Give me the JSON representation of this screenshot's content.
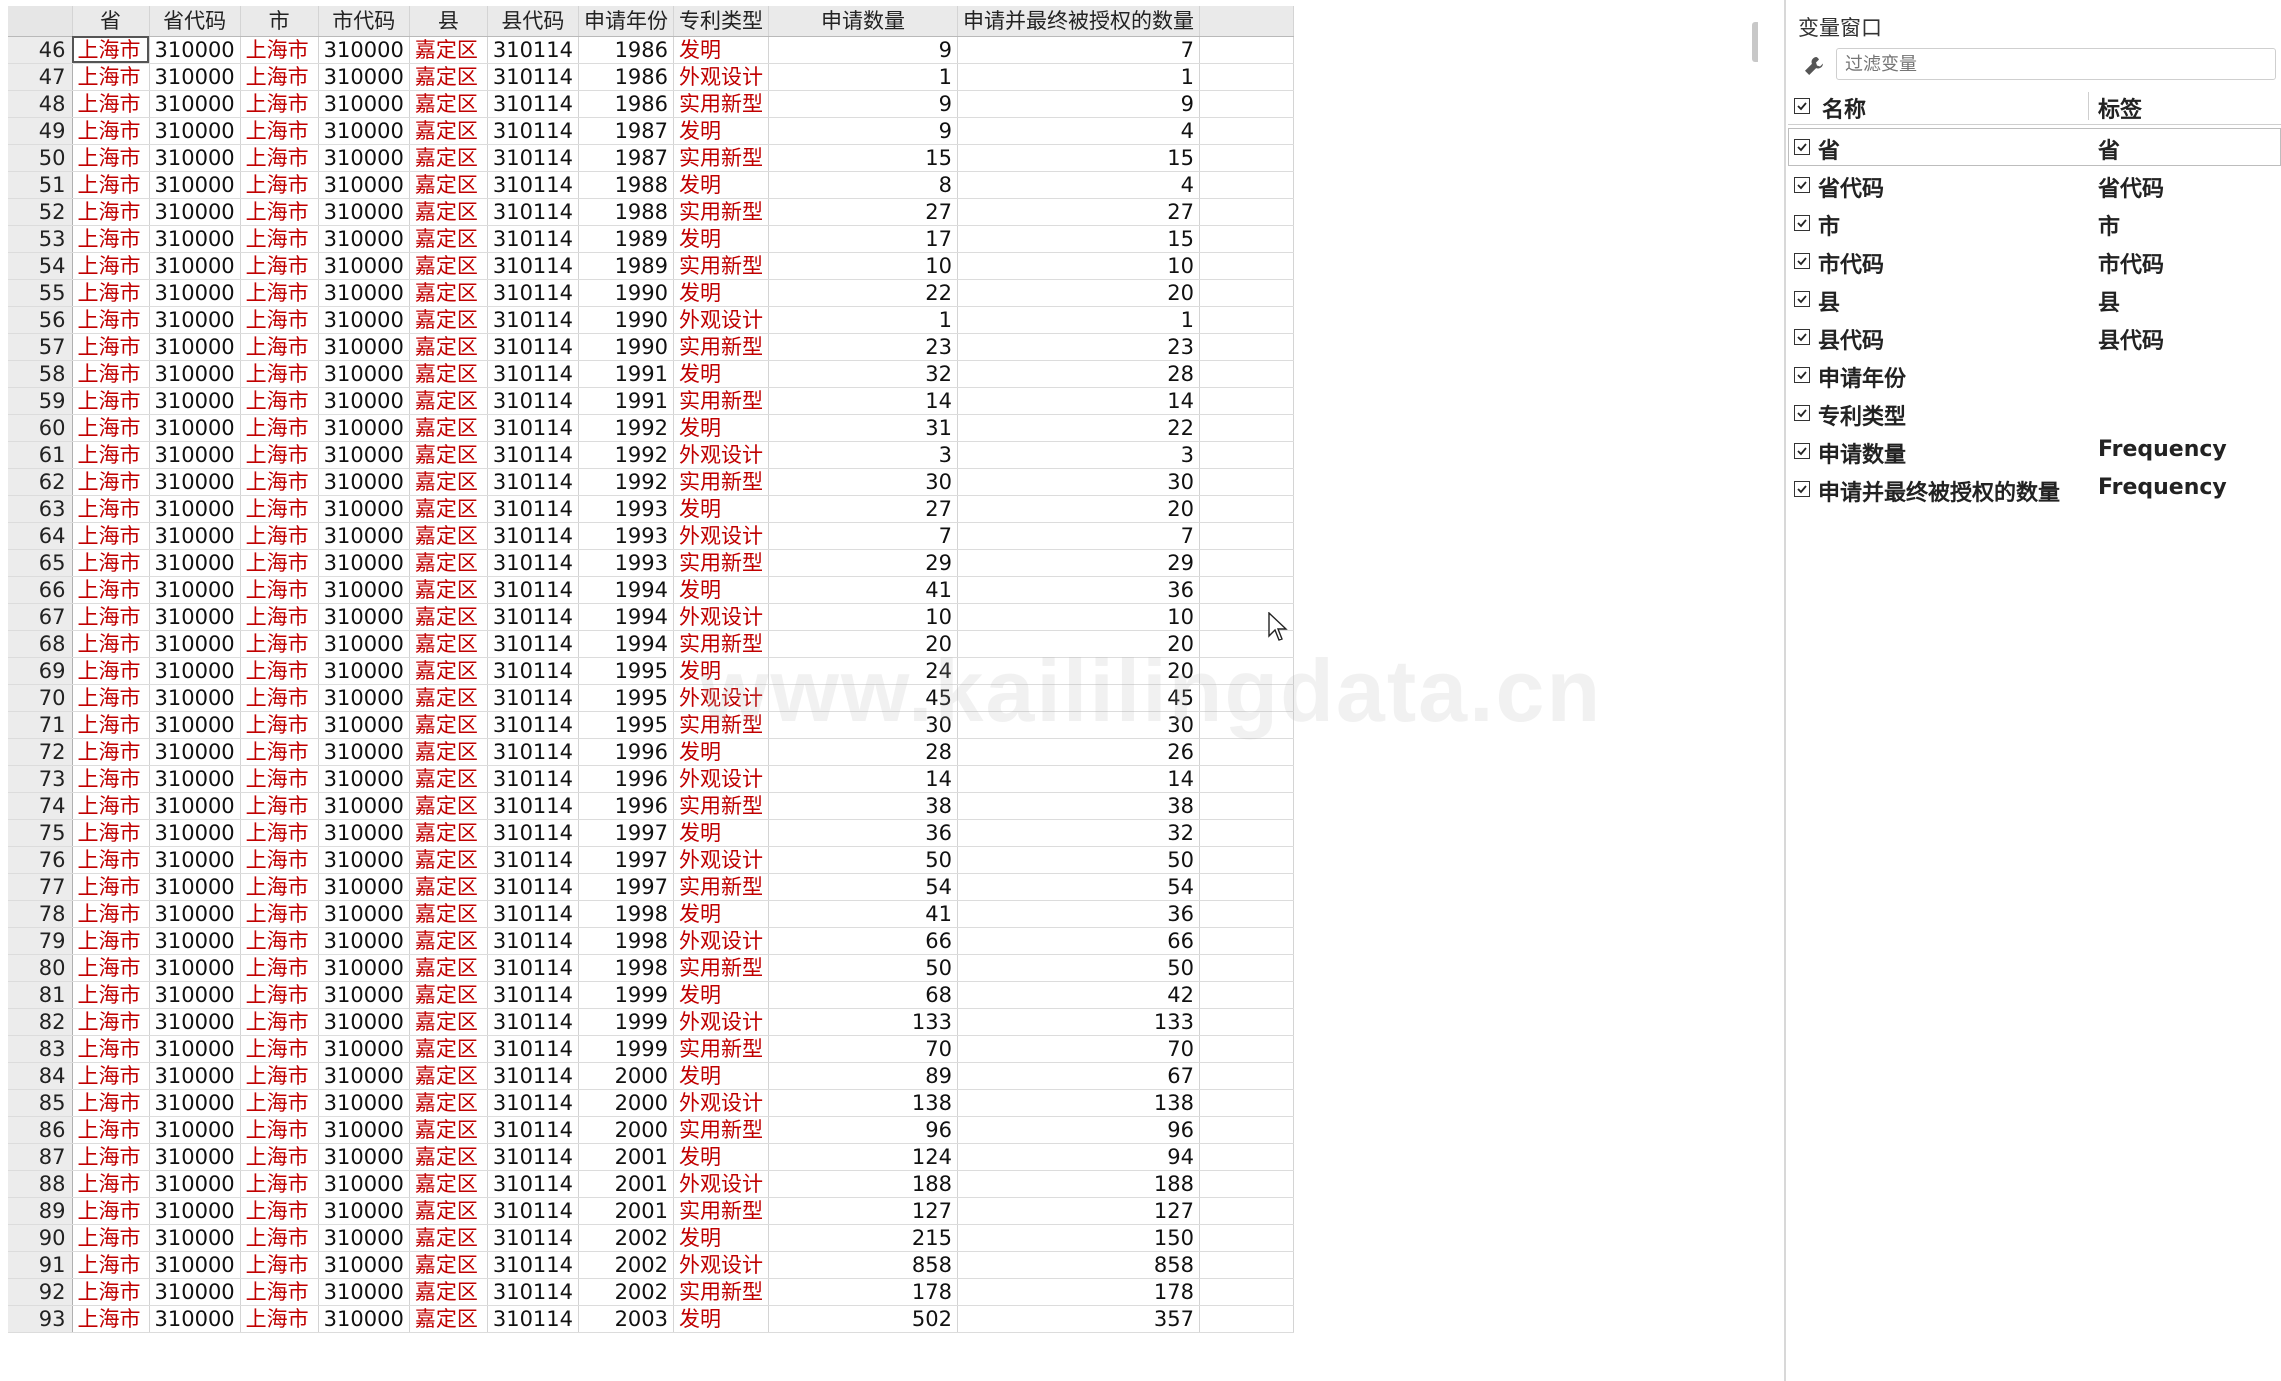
{
  "grid": {
    "columns": [
      "省",
      "省代码",
      "市",
      "市代码",
      "县",
      "县代码",
      "申请年份",
      "专利类型",
      "申请数量",
      "申请并最终被授权的数量"
    ],
    "rows": [
      [
        46,
        "上海市",
        "310000",
        "上海市",
        "310000",
        "嘉定区",
        "310114",
        "1986",
        "发明",
        "9",
        "7"
      ],
      [
        47,
        "上海市",
        "310000",
        "上海市",
        "310000",
        "嘉定区",
        "310114",
        "1986",
        "外观设计",
        "1",
        "1"
      ],
      [
        48,
        "上海市",
        "310000",
        "上海市",
        "310000",
        "嘉定区",
        "310114",
        "1986",
        "实用新型",
        "9",
        "9"
      ],
      [
        49,
        "上海市",
        "310000",
        "上海市",
        "310000",
        "嘉定区",
        "310114",
        "1987",
        "发明",
        "9",
        "4"
      ],
      [
        50,
        "上海市",
        "310000",
        "上海市",
        "310000",
        "嘉定区",
        "310114",
        "1987",
        "实用新型",
        "15",
        "15"
      ],
      [
        51,
        "上海市",
        "310000",
        "上海市",
        "310000",
        "嘉定区",
        "310114",
        "1988",
        "发明",
        "8",
        "4"
      ],
      [
        52,
        "上海市",
        "310000",
        "上海市",
        "310000",
        "嘉定区",
        "310114",
        "1988",
        "实用新型",
        "27",
        "27"
      ],
      [
        53,
        "上海市",
        "310000",
        "上海市",
        "310000",
        "嘉定区",
        "310114",
        "1989",
        "发明",
        "17",
        "15"
      ],
      [
        54,
        "上海市",
        "310000",
        "上海市",
        "310000",
        "嘉定区",
        "310114",
        "1989",
        "实用新型",
        "10",
        "10"
      ],
      [
        55,
        "上海市",
        "310000",
        "上海市",
        "310000",
        "嘉定区",
        "310114",
        "1990",
        "发明",
        "22",
        "20"
      ],
      [
        56,
        "上海市",
        "310000",
        "上海市",
        "310000",
        "嘉定区",
        "310114",
        "1990",
        "外观设计",
        "1",
        "1"
      ],
      [
        57,
        "上海市",
        "310000",
        "上海市",
        "310000",
        "嘉定区",
        "310114",
        "1990",
        "实用新型",
        "23",
        "23"
      ],
      [
        58,
        "上海市",
        "310000",
        "上海市",
        "310000",
        "嘉定区",
        "310114",
        "1991",
        "发明",
        "32",
        "28"
      ],
      [
        59,
        "上海市",
        "310000",
        "上海市",
        "310000",
        "嘉定区",
        "310114",
        "1991",
        "实用新型",
        "14",
        "14"
      ],
      [
        60,
        "上海市",
        "310000",
        "上海市",
        "310000",
        "嘉定区",
        "310114",
        "1992",
        "发明",
        "31",
        "22"
      ],
      [
        61,
        "上海市",
        "310000",
        "上海市",
        "310000",
        "嘉定区",
        "310114",
        "1992",
        "外观设计",
        "3",
        "3"
      ],
      [
        62,
        "上海市",
        "310000",
        "上海市",
        "310000",
        "嘉定区",
        "310114",
        "1992",
        "实用新型",
        "30",
        "30"
      ],
      [
        63,
        "上海市",
        "310000",
        "上海市",
        "310000",
        "嘉定区",
        "310114",
        "1993",
        "发明",
        "27",
        "20"
      ],
      [
        64,
        "上海市",
        "310000",
        "上海市",
        "310000",
        "嘉定区",
        "310114",
        "1993",
        "外观设计",
        "7",
        "7"
      ],
      [
        65,
        "上海市",
        "310000",
        "上海市",
        "310000",
        "嘉定区",
        "310114",
        "1993",
        "实用新型",
        "29",
        "29"
      ],
      [
        66,
        "上海市",
        "310000",
        "上海市",
        "310000",
        "嘉定区",
        "310114",
        "1994",
        "发明",
        "41",
        "36"
      ],
      [
        67,
        "上海市",
        "310000",
        "上海市",
        "310000",
        "嘉定区",
        "310114",
        "1994",
        "外观设计",
        "10",
        "10"
      ],
      [
        68,
        "上海市",
        "310000",
        "上海市",
        "310000",
        "嘉定区",
        "310114",
        "1994",
        "实用新型",
        "20",
        "20"
      ],
      [
        69,
        "上海市",
        "310000",
        "上海市",
        "310000",
        "嘉定区",
        "310114",
        "1995",
        "发明",
        "24",
        "20"
      ],
      [
        70,
        "上海市",
        "310000",
        "上海市",
        "310000",
        "嘉定区",
        "310114",
        "1995",
        "外观设计",
        "45",
        "45"
      ],
      [
        71,
        "上海市",
        "310000",
        "上海市",
        "310000",
        "嘉定区",
        "310114",
        "1995",
        "实用新型",
        "30",
        "30"
      ],
      [
        72,
        "上海市",
        "310000",
        "上海市",
        "310000",
        "嘉定区",
        "310114",
        "1996",
        "发明",
        "28",
        "26"
      ],
      [
        73,
        "上海市",
        "310000",
        "上海市",
        "310000",
        "嘉定区",
        "310114",
        "1996",
        "外观设计",
        "14",
        "14"
      ],
      [
        74,
        "上海市",
        "310000",
        "上海市",
        "310000",
        "嘉定区",
        "310114",
        "1996",
        "实用新型",
        "38",
        "38"
      ],
      [
        75,
        "上海市",
        "310000",
        "上海市",
        "310000",
        "嘉定区",
        "310114",
        "1997",
        "发明",
        "36",
        "32"
      ],
      [
        76,
        "上海市",
        "310000",
        "上海市",
        "310000",
        "嘉定区",
        "310114",
        "1997",
        "外观设计",
        "50",
        "50"
      ],
      [
        77,
        "上海市",
        "310000",
        "上海市",
        "310000",
        "嘉定区",
        "310114",
        "1997",
        "实用新型",
        "54",
        "54"
      ],
      [
        78,
        "上海市",
        "310000",
        "上海市",
        "310000",
        "嘉定区",
        "310114",
        "1998",
        "发明",
        "41",
        "36"
      ],
      [
        79,
        "上海市",
        "310000",
        "上海市",
        "310000",
        "嘉定区",
        "310114",
        "1998",
        "外观设计",
        "66",
        "66"
      ],
      [
        80,
        "上海市",
        "310000",
        "上海市",
        "310000",
        "嘉定区",
        "310114",
        "1998",
        "实用新型",
        "50",
        "50"
      ],
      [
        81,
        "上海市",
        "310000",
        "上海市",
        "310000",
        "嘉定区",
        "310114",
        "1999",
        "发明",
        "68",
        "42"
      ],
      [
        82,
        "上海市",
        "310000",
        "上海市",
        "310000",
        "嘉定区",
        "310114",
        "1999",
        "外观设计",
        "133",
        "133"
      ],
      [
        83,
        "上海市",
        "310000",
        "上海市",
        "310000",
        "嘉定区",
        "310114",
        "1999",
        "实用新型",
        "70",
        "70"
      ],
      [
        84,
        "上海市",
        "310000",
        "上海市",
        "310000",
        "嘉定区",
        "310114",
        "2000",
        "发明",
        "89",
        "67"
      ],
      [
        85,
        "上海市",
        "310000",
        "上海市",
        "310000",
        "嘉定区",
        "310114",
        "2000",
        "外观设计",
        "138",
        "138"
      ],
      [
        86,
        "上海市",
        "310000",
        "上海市",
        "310000",
        "嘉定区",
        "310114",
        "2000",
        "实用新型",
        "96",
        "96"
      ],
      [
        87,
        "上海市",
        "310000",
        "上海市",
        "310000",
        "嘉定区",
        "310114",
        "2001",
        "发明",
        "124",
        "94"
      ],
      [
        88,
        "上海市",
        "310000",
        "上海市",
        "310000",
        "嘉定区",
        "310114",
        "2001",
        "外观设计",
        "188",
        "188"
      ],
      [
        89,
        "上海市",
        "310000",
        "上海市",
        "310000",
        "嘉定区",
        "310114",
        "2001",
        "实用新型",
        "127",
        "127"
      ],
      [
        90,
        "上海市",
        "310000",
        "上海市",
        "310000",
        "嘉定区",
        "310114",
        "2002",
        "发明",
        "215",
        "150"
      ],
      [
        91,
        "上海市",
        "310000",
        "上海市",
        "310000",
        "嘉定区",
        "310114",
        "2002",
        "外观设计",
        "858",
        "858"
      ],
      [
        92,
        "上海市",
        "310000",
        "上海市",
        "310000",
        "嘉定区",
        "310114",
        "2002",
        "实用新型",
        "178",
        "178"
      ],
      [
        93,
        "上海市",
        "310000",
        "上海市",
        "310000",
        "嘉定区",
        "310114",
        "2003",
        "发明",
        "502",
        "357"
      ]
    ]
  },
  "watermark": "www.kaililingdata.cn",
  "variables_window": {
    "title": "变量窗口",
    "filter_placeholder": "过滤变量",
    "header_name": "名称",
    "header_label": "标签",
    "variables": [
      {
        "name": "省",
        "label": "省"
      },
      {
        "name": "省代码",
        "label": "省代码"
      },
      {
        "name": "市",
        "label": "市"
      },
      {
        "name": "市代码",
        "label": "市代码"
      },
      {
        "name": "县",
        "label": "县"
      },
      {
        "name": "县代码",
        "label": "县代码"
      },
      {
        "name": "申请年份",
        "label": ""
      },
      {
        "name": "专利类型",
        "label": ""
      },
      {
        "name": "申请数量",
        "label": "Frequency"
      },
      {
        "name": "申请并最终被授权的数量",
        "label": "Frequency"
      }
    ]
  },
  "colors": {
    "string_text": "#c00000",
    "numeric_text": "#111111",
    "header_bg": "#eaeaea"
  }
}
